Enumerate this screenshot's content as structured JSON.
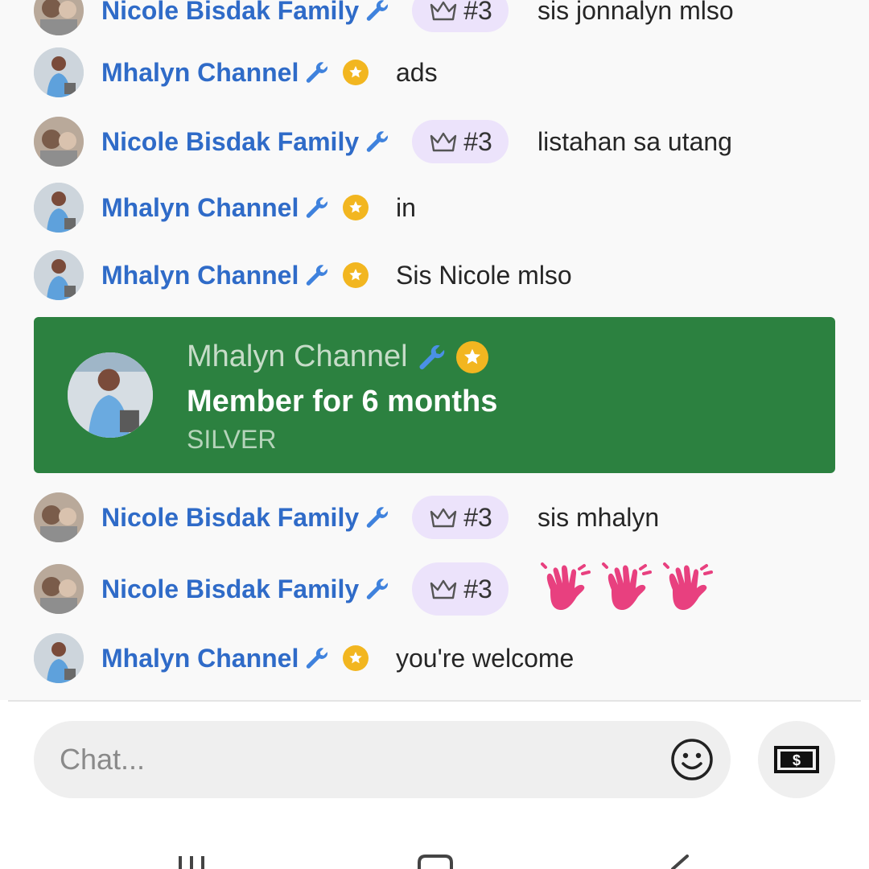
{
  "messages": [
    {
      "author": "Nicole Bisdak Family",
      "rank": "#3",
      "text": "sis jonnalyn mlso"
    },
    {
      "author": "Mhalyn Channel",
      "text": "ads"
    },
    {
      "author": "Nicole Bisdak Family",
      "rank": "#3",
      "text": "listahan sa utang"
    },
    {
      "author": "Mhalyn Channel",
      "text": "in"
    },
    {
      "author": "Mhalyn Channel",
      "text": "Sis Nicole mlso"
    },
    {
      "author": "Nicole Bisdak Family",
      "rank": "#3",
      "text": "sis mhalyn"
    },
    {
      "author": "Nicole Bisdak Family",
      "rank": "#3",
      "text": "waving-hands-emoji"
    },
    {
      "author": "Mhalyn Channel",
      "text": "you're welcome"
    }
  ],
  "milestone": {
    "author": "Mhalyn Channel",
    "headline": "Member for 6 months",
    "level": "SILVER"
  },
  "input": {
    "placeholder": "Chat..."
  },
  "icons": {
    "moderator": "wrench-icon",
    "member": "member-star-badge-icon",
    "rank": "crown-icon",
    "emoji": "smiley-icon",
    "super_chat": "dollar-bill-icon",
    "nav": [
      "recent-apps-icon",
      "home-icon",
      "back-icon"
    ]
  },
  "colors": {
    "author_blue": "#2f6bc8",
    "milestone_green": "#2c8140",
    "rank_chip": "#ece3fb",
    "member_gold": "#f2b620",
    "wave_pink": "#e8407f"
  }
}
